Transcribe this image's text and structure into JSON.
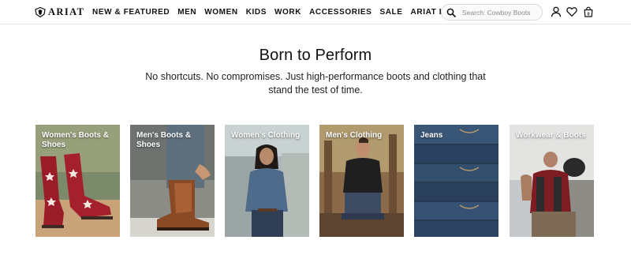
{
  "header": {
    "logo_text": "ARIAT",
    "nav": [
      {
        "label": "NEW & FEATURED"
      },
      {
        "label": "MEN"
      },
      {
        "label": "WOMEN"
      },
      {
        "label": "KIDS"
      },
      {
        "label": "WORK"
      },
      {
        "label": "ACCESSORIES"
      },
      {
        "label": "SALE"
      },
      {
        "label": "ARIAT LIFE"
      }
    ],
    "search": {
      "placeholder": "Search: Cowboy Boots",
      "value": ""
    },
    "icons": [
      "search-icon",
      "account-icon",
      "wishlist-heart-icon",
      "cart-bag-icon"
    ],
    "cart_count": "0"
  },
  "hero": {
    "title": "Born to Perform",
    "subtitle": "No shortcuts. No compromises. Just high-performance boots and clothing that stand the test of time."
  },
  "categories": [
    {
      "label": "Women's Boots & Shoes"
    },
    {
      "label": "Men's Boots & Shoes"
    },
    {
      "label": "Women's Clothing"
    },
    {
      "label": "Men's Clothing"
    },
    {
      "label": "Jeans"
    },
    {
      "label": "Workwear & Boots"
    }
  ],
  "colors": {
    "text": "#111111",
    "background": "#ffffff",
    "divider": "#e6e6e6"
  }
}
